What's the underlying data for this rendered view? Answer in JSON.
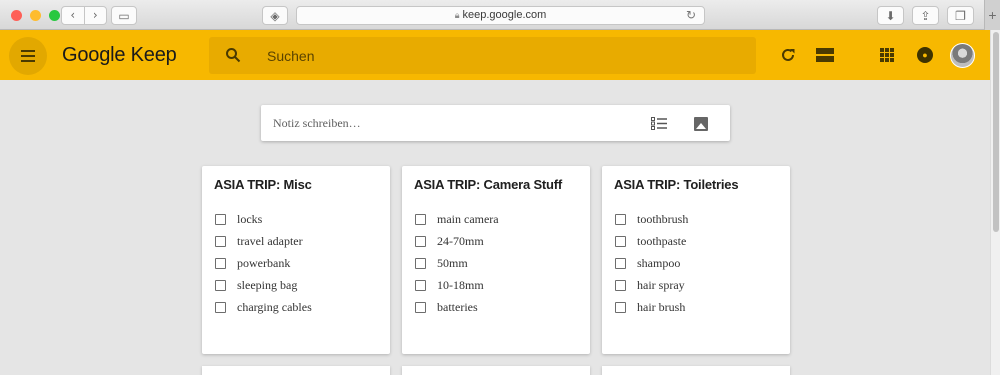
{
  "browser": {
    "url": "keep.google.com",
    "colors": {
      "close": "#fe5f57",
      "minimize": "#febc2e",
      "zoom": "#28c840"
    }
  },
  "header": {
    "brand": "Google Keep",
    "search_placeholder": "Suchen",
    "color": "#f7b800"
  },
  "composer": {
    "placeholder": "Notiz schreiben…"
  },
  "notes": [
    {
      "title": "ASIA TRIP: Misc",
      "items": [
        "locks",
        "travel adapter",
        "powerbank",
        "sleeping bag",
        "charging cables"
      ]
    },
    {
      "title": "ASIA TRIP: Camera Stuff",
      "items": [
        "main camera",
        "24-70mm",
        "50mm",
        "10-18mm",
        "batteries"
      ]
    },
    {
      "title": "ASIA TRIP: Toiletries",
      "items": [
        "toothbrush",
        "toothpaste",
        "shampoo",
        "hair spray",
        "hair brush"
      ]
    }
  ]
}
